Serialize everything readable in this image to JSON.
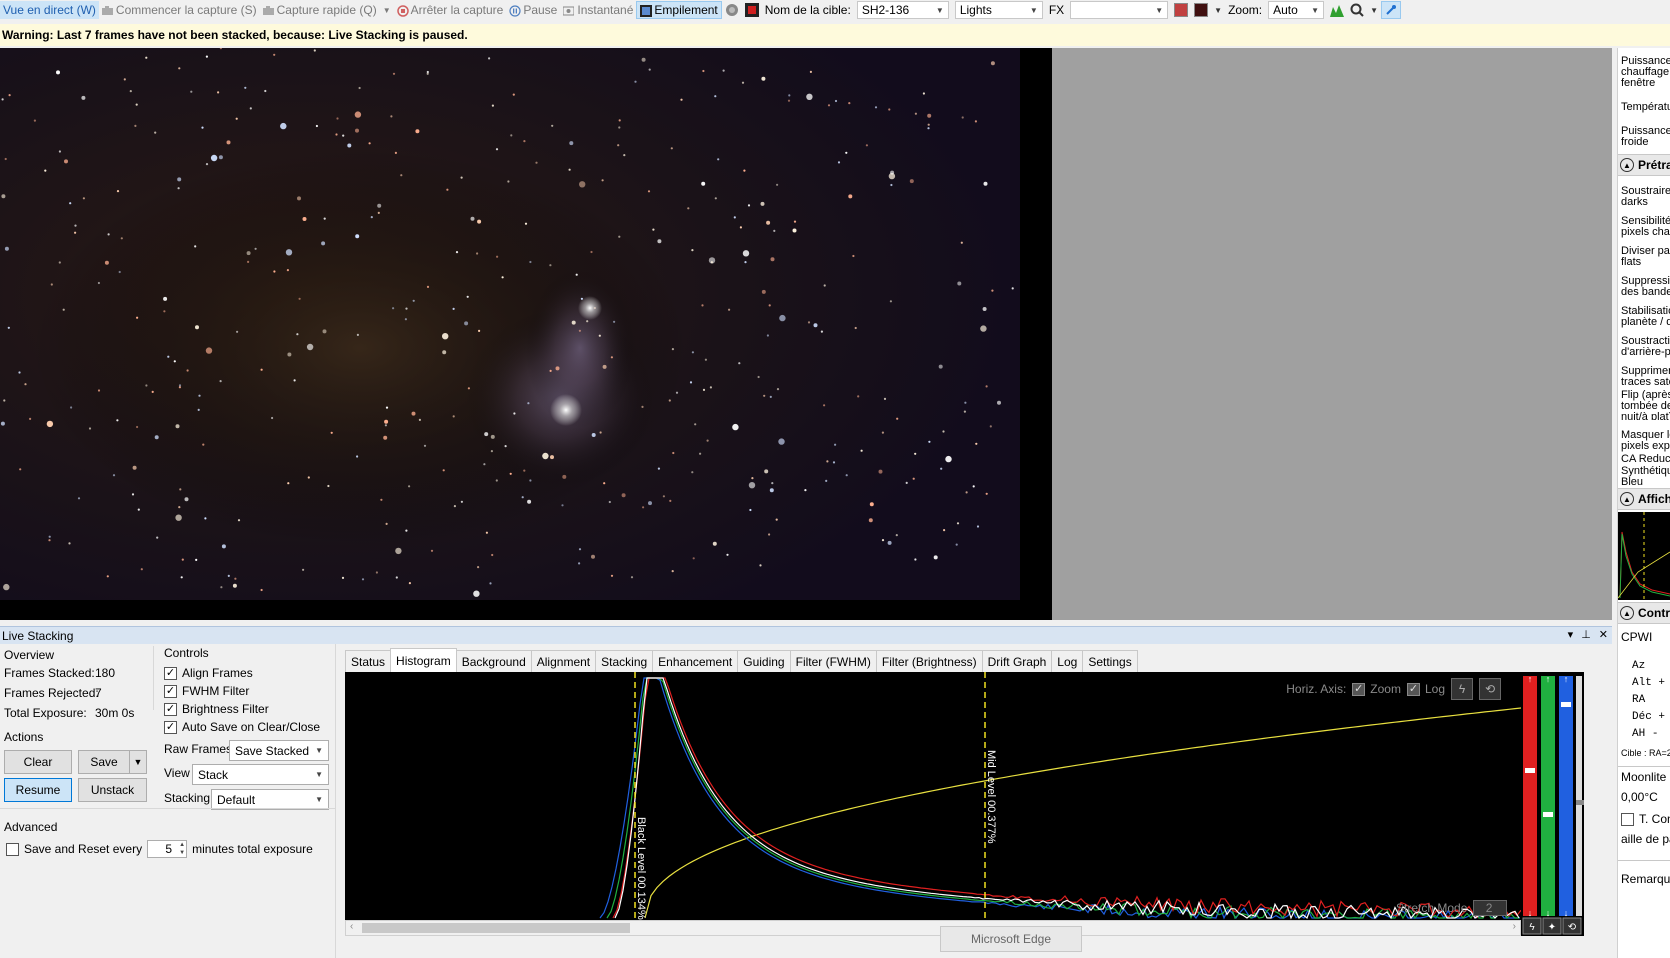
{
  "toolbar": {
    "live_view": "Vue en direct (W)",
    "start_capture": "Commencer la capture (S)",
    "quick_capture": "Capture rapide (Q)",
    "stop_capture": "Arrêter la capture",
    "pause": "Pause",
    "snapshot": "Instantané",
    "stacking": "Empilement",
    "target_label": "Nom de la cible:",
    "target_value": "SH2-136",
    "frame_type": "Lights",
    "fx_label": "FX",
    "fx_value": "",
    "zoom_label": "Zoom:",
    "zoom_value": "Auto"
  },
  "warning": "Warning: Last 7 frames have not been stacked, because: Live Stacking is paused.",
  "right_panel": {
    "items": [
      "Puissance chauffage fenêtre",
      "Températu",
      "Puissance froide"
    ],
    "section_pretreat": "Prétra",
    "pretreat_items": [
      "Soustraire darks",
      "Sensibilité pixels chau",
      "Diviser par flats",
      "Suppressic des bande",
      "Stabilisatic planète / d",
      "Soustractic d'arrière-pl",
      "Supprimer traces sate",
      "Flip (après tombée de nuit/à plat)",
      "Masquer le pixels expo",
      "CA Reduct",
      "Synthétique Bleu"
    ],
    "section_display": "Affich",
    "section_control": "Contr",
    "control_name": "CPWI",
    "coords": [
      [
        "Az",
        ""
      ],
      [
        "Alt",
        "+"
      ],
      [
        "RA",
        ""
      ],
      [
        "Déc",
        "+"
      ],
      [
        "AH",
        "-"
      ]
    ],
    "target_ra": "Cible : RA=2",
    "moonlite": "Moonlite I",
    "moonlite_temp": "0,00°C",
    "temp_comp": "T. Con",
    "step_size": "aille de pa",
    "remarks": "Remarque"
  },
  "live_stacking": {
    "title": "Live Stacking",
    "overview_title": "Overview",
    "frames_stacked_label": "Frames Stacked:",
    "frames_stacked": "180",
    "frames_rejected_label": "Frames Rejected:",
    "frames_rejected": "7",
    "total_exposure_label": "Total Exposure:",
    "total_exposure": "30m 0s",
    "controls_title": "Controls",
    "controls": [
      {
        "label": "Align Frames",
        "checked": true
      },
      {
        "label": "FWHM Filter",
        "checked": true
      },
      {
        "label": "Brightness Filter",
        "checked": true
      },
      {
        "label": "Auto Save on Clear/Close",
        "checked": true
      }
    ],
    "raw_frames_label": "Raw Frames",
    "raw_frames_value": "Save Stacked",
    "view_label": "View",
    "view_value": "Stack",
    "stacking_label": "Stacking",
    "stacking_value": "Default",
    "actions_title": "Actions",
    "btn_clear": "Clear",
    "btn_save": "Save",
    "btn_resume": "Resume",
    "btn_unstack": "Unstack",
    "advanced_title": "Advanced",
    "save_reset_label": "Save and Reset every",
    "save_reset_value": "5",
    "save_reset_suffix": "minutes total exposure"
  },
  "tabs": [
    "Status",
    "Histogram",
    "Background",
    "Alignment",
    "Stacking",
    "Enhancement",
    "Guiding",
    "Filter (FWHM)",
    "Filter (Brightness)",
    "Drift Graph",
    "Log",
    "Settings"
  ],
  "active_tab": "Histogram",
  "histogram": {
    "horiz_axis_label": "Horiz. Axis:",
    "zoom_label": "Zoom",
    "zoom_checked": true,
    "log_label": "Log",
    "log_checked": true,
    "black_level": "Black Level 00.134%",
    "mid_level": "Mid Level 00.377%",
    "stretch_mode_label": "Stretch Mode",
    "stretch_mode_value": "2",
    "colors": {
      "red": "#e02020",
      "green": "#20b040",
      "blue": "#2060e0",
      "white": "#ffffff",
      "curve": "#e8e040",
      "marker": "#f0e020"
    }
  },
  "taskbar_tip": "Microsoft Edge"
}
